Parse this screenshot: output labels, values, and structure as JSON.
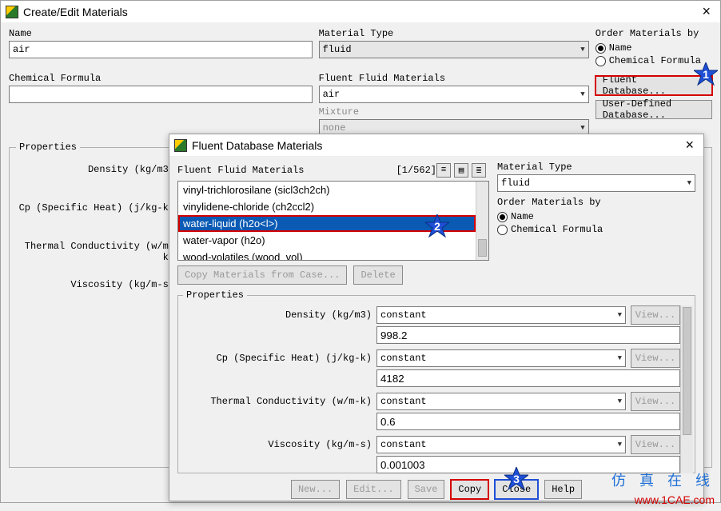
{
  "parent": {
    "title": "Create/Edit Materials",
    "close": "×",
    "name_label": "Name",
    "name_value": "air",
    "formula_label": "Chemical Formula",
    "formula_value": "",
    "mat_type_label": "Material Type",
    "mat_type_value": "fluid",
    "fluid_mat_label": "Fluent Fluid Materials",
    "fluid_mat_value": "air",
    "mixture_label": "Mixture",
    "mixture_value": "none",
    "order_label": "Order Materials by",
    "order_name": "Name",
    "order_formula": "Chemical Formula",
    "btn_fluent_db": "Fluent Database...",
    "btn_user_db": "User-Defined Database...",
    "props_label": "Properties",
    "prop_density": "Density (kg/m3)",
    "prop_cp": "Cp (Specific Heat) (j/kg-k)",
    "prop_tc": "Thermal Conductivity (w/m-k)",
    "prop_visc": "Viscosity (kg/m-s)"
  },
  "child": {
    "title": "Fluent Database Materials",
    "close": "×",
    "list_label": "Fluent Fluid Materials",
    "list_count": "[1/562]",
    "items": [
      "vinyl-trichlorosilane (sicl3ch2ch)",
      "vinylidene-chloride (ch2ccl2)",
      "water-liquid (h2o<l>)",
      "water-vapor (h2o)",
      "wood-volatiles (wood_vol)"
    ],
    "selected_index": 2,
    "copy_case": "Copy Materials from Case...",
    "delete": "Delete",
    "mat_type_label": "Material Type",
    "mat_type_value": "fluid",
    "order_label": "Order Materials by",
    "order_name": "Name",
    "order_formula": "Chemical Formula",
    "props_label": "Properties",
    "props": [
      {
        "label": "Density (kg/m3)",
        "method": "constant",
        "value": "998.2"
      },
      {
        "label": "Cp (Specific Heat) (j/kg-k)",
        "method": "constant",
        "value": "4182"
      },
      {
        "label": "Thermal Conductivity (w/m-k)",
        "method": "constant",
        "value": "0.6"
      },
      {
        "label": "Viscosity (kg/m-s)",
        "method": "constant",
        "value": "0.001003"
      }
    ],
    "view": "View...",
    "btns": {
      "new": "New...",
      "edit": "Edit...",
      "save": "Save",
      "copy": "Copy",
      "close": "Close",
      "help": "Help"
    }
  },
  "stars": {
    "s1": "1",
    "s2": "2",
    "s3": "3"
  },
  "watermarks": {
    "big": ".1CAE.COM.",
    "cn": "仿 真 在 线",
    "url": "www.1CAE.com"
  }
}
